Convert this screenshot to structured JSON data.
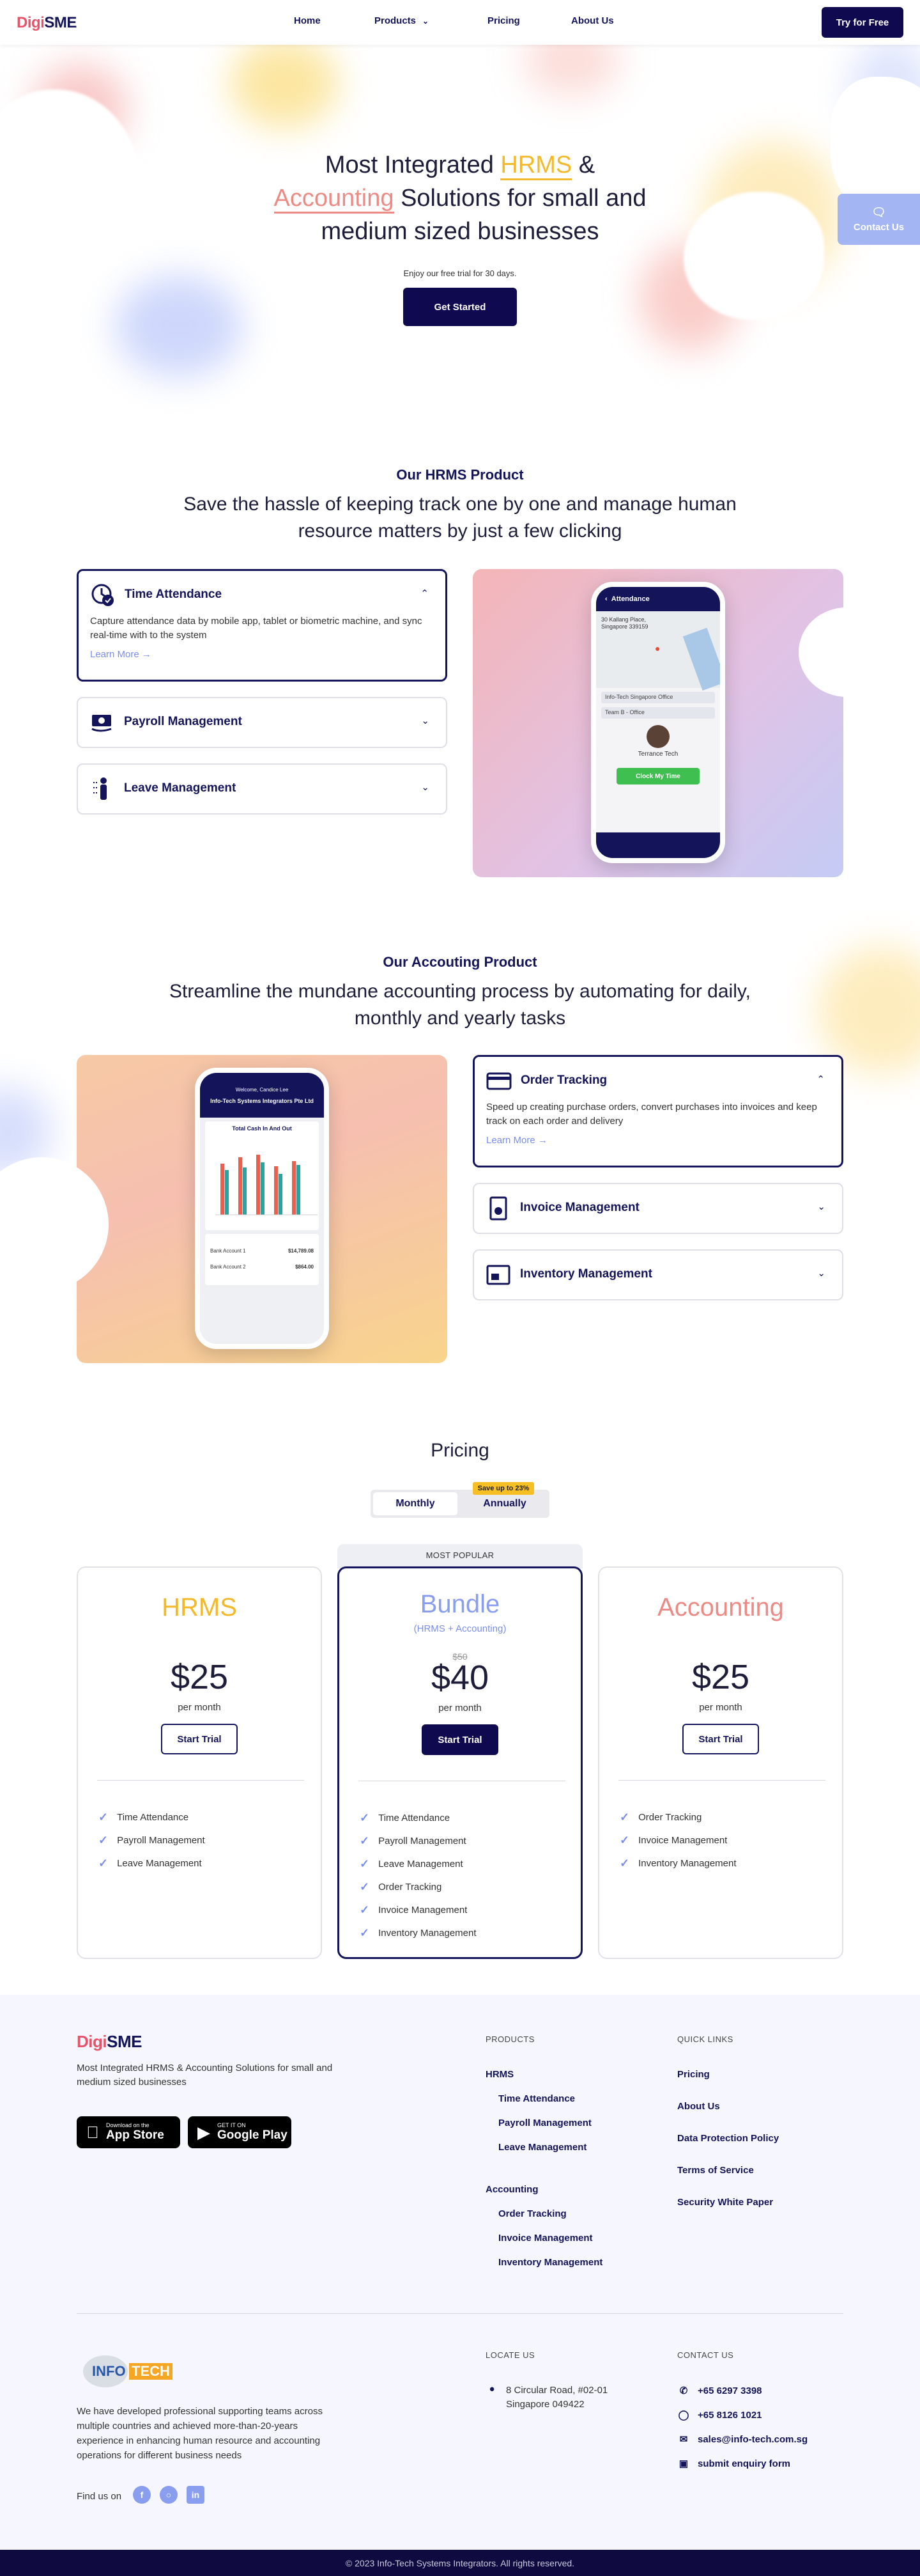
{
  "nav": {
    "logo_prefix": "Digi",
    "logo_suffix": "SME",
    "home": "Home",
    "products": "Products",
    "pricing": "Pricing",
    "about": "About Us",
    "cta": "Try for Free"
  },
  "hero": {
    "title_line1_a": "Most Integrated ",
    "title_hl1": "HRMS",
    "title_line1_b": " &",
    "title_hl2": "Accounting",
    "title_line2": " Solutions for small and",
    "title_line3": "medium sized businesses",
    "sub": "Enjoy our free trial for 30 days.",
    "cta": "Get Started",
    "contact": "Contact Us"
  },
  "hrms": {
    "kicker": "Our HRMS Product",
    "title": "Save the hassle of keeping track one by one and manage human resource matters by just a few clicking",
    "items": [
      {
        "title": "Time Attendance",
        "desc": "Capture attendance data by mobile app, tablet or biometric machine, and sync real-time with to the system",
        "more": "Learn More"
      },
      {
        "title": "Payroll Management"
      },
      {
        "title": "Leave Management"
      }
    ],
    "phone": {
      "screen_title": "Attendance",
      "address_line1": "30 Kallang Place,",
      "address_line2": "Singapore 339159",
      "office": "Info-Tech Singapore Office",
      "team": "Team B - Office",
      "person": "Terrance Tech",
      "cta": "Clock My Time"
    }
  },
  "accounting": {
    "kicker": "Our Accouting Product",
    "title": "Streamline the mundane accounting process by automating for daily, monthly and yearly tasks",
    "items": [
      {
        "title": "Order Tracking",
        "desc": "Speed up creating purchase orders, convert purchases into invoices and keep track on each order and delivery",
        "more": "Learn More"
      },
      {
        "title": "Invoice Management"
      },
      {
        "title": "Inventory Management"
      }
    ],
    "phone": {
      "welcome": "Welcome, Candice Lee",
      "company": "Info-Tech Systems Integrators Pte Ltd",
      "chart_title": "Total Cash In And Out",
      "acct1_name": "Bank Account 1",
      "acct1_value": "$14,789.08",
      "acct2_name": "Bank Account 2",
      "acct2_value": "$864.00"
    }
  },
  "pricing": {
    "title": "Pricing",
    "monthly": "Monthly",
    "annually": "Annually",
    "save_badge": "Save up to 23%",
    "popular": "MOST POPULAR",
    "plans": [
      {
        "name": "HRMS",
        "price": "$25",
        "per": "per month",
        "cta": "Start Trial",
        "color": "#f2b92b",
        "features": [
          "Time Attendance",
          "Payroll Management",
          "Leave Management"
        ]
      },
      {
        "name": "Bundle",
        "sub": "(HRMS + Accounting)",
        "old_price": "$50",
        "price": "$40",
        "per": "per month",
        "cta": "Start Trial",
        "color": "#8a9ef0",
        "features": [
          "Time Attendance",
          "Payroll Management",
          "Leave Management",
          "Order Tracking",
          "Invoice Management",
          "Inventory Management"
        ]
      },
      {
        "name": "Accounting",
        "price": "$25",
        "per": "per month",
        "cta": "Start Trial",
        "color": "#ec8b86",
        "features": [
          "Order Tracking",
          "Invoice Management",
          "Inventory Management"
        ]
      }
    ]
  },
  "footer": {
    "logo_prefix": "Digi",
    "logo_suffix": "SME",
    "tagline": "Most Integrated HRMS & Accounting Solutions for small and medium sized businesses",
    "appstore_small": "Download on the",
    "appstore_big": "App Store",
    "gplay_small": "GET IT ON",
    "gplay_big": "Google Play",
    "products_head": "PRODUCTS",
    "hrms": "HRMS",
    "time_attendance": "Time Attendance",
    "payroll": "Payroll Management",
    "leave": "Leave Management",
    "accounting": "Accounting",
    "order_tracking": "Order Tracking",
    "invoice": "Invoice Management",
    "inventory": "Inventory Management",
    "quick_head": "QUICK LINKS",
    "q_pricing": "Pricing",
    "q_about": "About Us",
    "q_dpp": "Data Protection Policy",
    "q_terms": "Terms of Service",
    "q_security": "Security White Paper",
    "infotech_a": "INFO",
    "infotech_b": "TECH",
    "about": "We have developed professional supporting teams across multiple countries and achieved more-than-20-years experience in enhancing human resource and accounting operations for different business needs",
    "find_us": "Find us on",
    "locate_head": "LOCATE US",
    "address1": "8 Circular Road, #02-01",
    "address2": "Singapore 049422",
    "contact_head": "CONTACT US",
    "phone": "+65 6297 3398",
    "whatsapp": "+65 8126 1021",
    "email": "sales@info-tech.com.sg",
    "enquiry": "submit enquiry form",
    "copyright": "© 2023 Info-Tech Systems Integrators. All rights reserved."
  }
}
